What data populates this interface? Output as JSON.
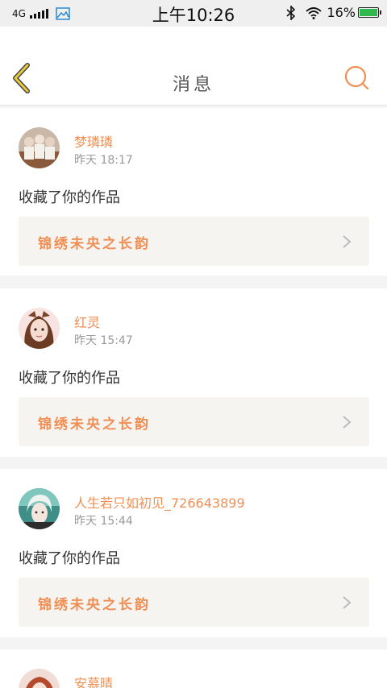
{
  "status_bar": {
    "network": "4G",
    "time": "上午10:26",
    "battery": "16%"
  },
  "nav": {
    "title": "消息"
  },
  "messages": [
    {
      "username": "梦璘璘",
      "time": "昨天 18:17",
      "action": "收藏了你的作品",
      "work": "锦绣未央之长韵"
    },
    {
      "username": "红灵",
      "time": "昨天 15:47",
      "action": "收藏了你的作品",
      "work": "锦绣未央之长韵"
    },
    {
      "username": "人生若只如初见_726643899",
      "time": "昨天 15:44",
      "action": "收藏了你的作品",
      "work": "锦绣未央之长韵"
    },
    {
      "username": "安慕晴"
    }
  ],
  "colors": {
    "accent": "#ef8f55",
    "back_arrow": "#e8c93c",
    "link_bg": "#f6f4f0",
    "page_bg": "#f4f4f4"
  }
}
